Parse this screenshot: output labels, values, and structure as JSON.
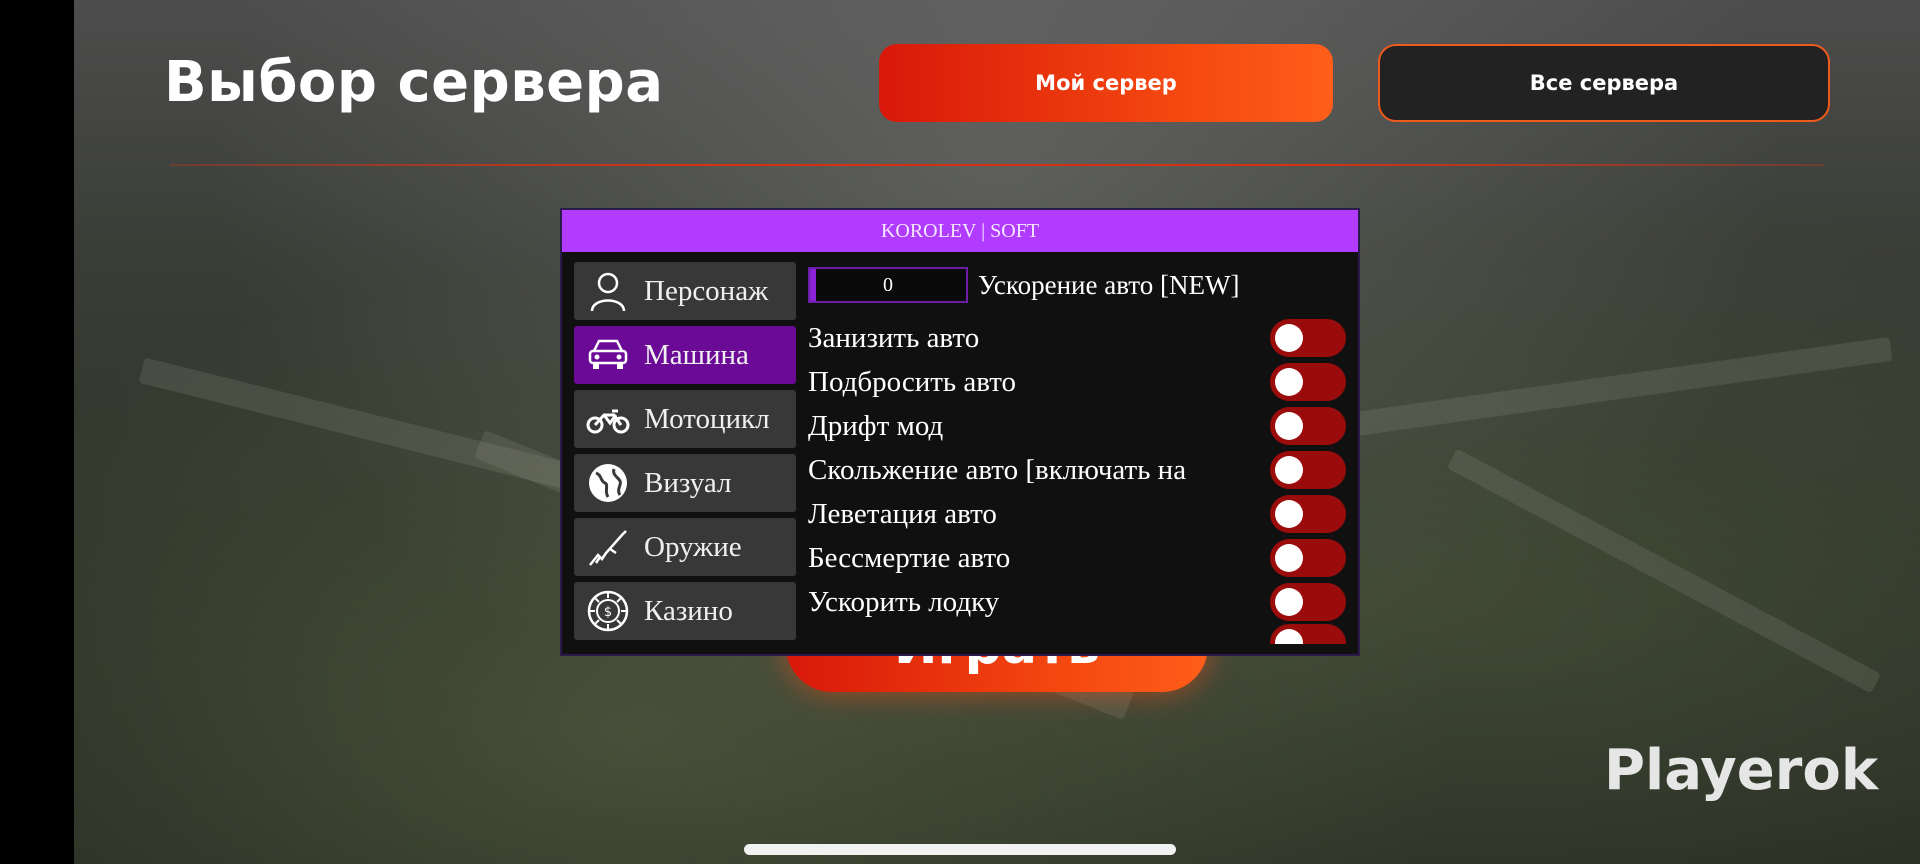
{
  "header": {
    "title": "Выбор сервера",
    "my_server_label": "Мой сервер",
    "all_servers_label": "Все сервера"
  },
  "play_button_label": "Играть",
  "brand": "Playerok",
  "menu": {
    "title": "KOROLEV | SOFT",
    "nav": [
      {
        "label": "Персонаж",
        "icon": "person-icon",
        "active": false
      },
      {
        "label": "Машина",
        "icon": "car-icon",
        "active": true
      },
      {
        "label": "Мотоцикл",
        "icon": "motorcycle-icon",
        "active": false
      },
      {
        "label": "Визуал",
        "icon": "globe-icon",
        "active": false
      },
      {
        "label": "Оружие",
        "icon": "rifle-icon",
        "active": false
      },
      {
        "label": "Казино",
        "icon": "casino-chip-icon",
        "active": false
      }
    ],
    "slider": {
      "value": "0",
      "label": "Ускорение авто [NEW]"
    },
    "toggles": [
      {
        "label": "Занизить авто",
        "on": false
      },
      {
        "label": "Подбросить авто",
        "on": false
      },
      {
        "label": "Дрифт мод",
        "on": false
      },
      {
        "label": "Скольжение авто [включать на",
        "on": false
      },
      {
        "label": "Леветация авто",
        "on": false
      },
      {
        "label": "Бессмертие авто",
        "on": false
      },
      {
        "label": "Ускорить лодку",
        "on": false
      }
    ]
  },
  "colors": {
    "accent_orange": "#f2440f",
    "menu_purple": "#b13bff",
    "active_nav": "#6a0a96",
    "toggle_off": "#9a0b0b"
  }
}
